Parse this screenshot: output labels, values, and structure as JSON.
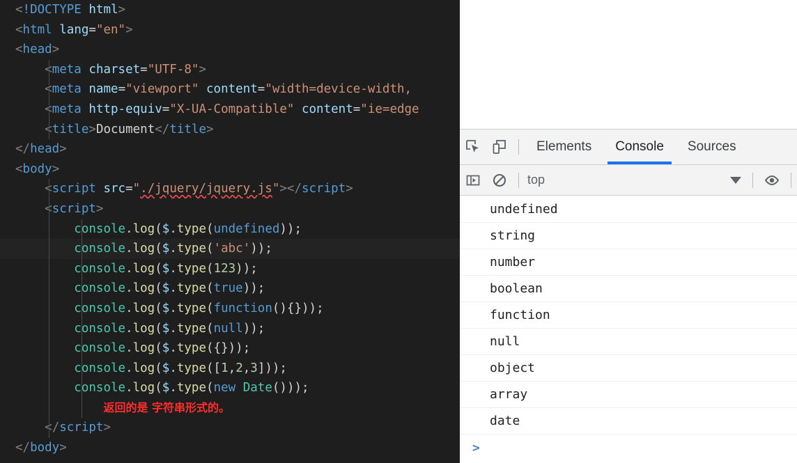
{
  "editor": {
    "language": "html",
    "background": "#1e1e1e",
    "lines": [
      {
        "indent": 0,
        "guides": 0,
        "highlight": false,
        "tokens": [
          {
            "t": "punct",
            "s": "<"
          },
          {
            "t": "doctype",
            "s": "!DOCTYPE"
          },
          {
            "t": "text",
            "s": " "
          },
          {
            "t": "dt-word",
            "s": "html"
          },
          {
            "t": "punct",
            "s": ">"
          }
        ]
      },
      {
        "indent": 0,
        "guides": 0,
        "highlight": false,
        "tokens": [
          {
            "t": "punct",
            "s": "<"
          },
          {
            "t": "tag",
            "s": "html"
          },
          {
            "t": "text",
            "s": " "
          },
          {
            "t": "attr",
            "s": "lang"
          },
          {
            "t": "op",
            "s": "="
          },
          {
            "t": "str",
            "s": "\"en\""
          },
          {
            "t": "punct",
            "s": ">"
          }
        ]
      },
      {
        "indent": 0,
        "guides": 0,
        "highlight": false,
        "tokens": [
          {
            "t": "punct",
            "s": "<"
          },
          {
            "t": "tag",
            "s": "head"
          },
          {
            "t": "punct",
            "s": ">"
          }
        ]
      },
      {
        "indent": 1,
        "guides": 1,
        "highlight": false,
        "tokens": [
          {
            "t": "punct",
            "s": "<"
          },
          {
            "t": "tag",
            "s": "meta"
          },
          {
            "t": "text",
            "s": " "
          },
          {
            "t": "attr",
            "s": "charset"
          },
          {
            "t": "op",
            "s": "="
          },
          {
            "t": "str",
            "s": "\"UTF-8\""
          },
          {
            "t": "punct",
            "s": ">"
          }
        ]
      },
      {
        "indent": 1,
        "guides": 1,
        "highlight": false,
        "tokens": [
          {
            "t": "punct",
            "s": "<"
          },
          {
            "t": "tag",
            "s": "meta"
          },
          {
            "t": "text",
            "s": " "
          },
          {
            "t": "attr",
            "s": "name"
          },
          {
            "t": "op",
            "s": "="
          },
          {
            "t": "str",
            "s": "\"viewport\""
          },
          {
            "t": "text",
            "s": " "
          },
          {
            "t": "attr",
            "s": "content"
          },
          {
            "t": "op",
            "s": "="
          },
          {
            "t": "str",
            "s": "\"width=device-width,"
          }
        ]
      },
      {
        "indent": 1,
        "guides": 1,
        "highlight": false,
        "tokens": [
          {
            "t": "punct",
            "s": "<"
          },
          {
            "t": "tag",
            "s": "meta"
          },
          {
            "t": "text",
            "s": " "
          },
          {
            "t": "attr",
            "s": "http-equiv"
          },
          {
            "t": "op",
            "s": "="
          },
          {
            "t": "str",
            "s": "\"X-UA-Compatible\""
          },
          {
            "t": "text",
            "s": " "
          },
          {
            "t": "attr",
            "s": "content"
          },
          {
            "t": "op",
            "s": "="
          },
          {
            "t": "str",
            "s": "\"ie=edge"
          }
        ]
      },
      {
        "indent": 1,
        "guides": 1,
        "highlight": false,
        "tokens": [
          {
            "t": "punct",
            "s": "<"
          },
          {
            "t": "tag",
            "s": "title"
          },
          {
            "t": "punct",
            "s": ">"
          },
          {
            "t": "text",
            "s": "Document"
          },
          {
            "t": "punct",
            "s": "</"
          },
          {
            "t": "tag",
            "s": "title"
          },
          {
            "t": "punct",
            "s": ">"
          }
        ]
      },
      {
        "indent": 0,
        "guides": 0,
        "highlight": false,
        "tokens": [
          {
            "t": "punct",
            "s": "</"
          },
          {
            "t": "tag",
            "s": "head"
          },
          {
            "t": "punct",
            "s": ">"
          }
        ]
      },
      {
        "indent": 0,
        "guides": 0,
        "highlight": false,
        "tokens": [
          {
            "t": "punct",
            "s": "<"
          },
          {
            "t": "tag",
            "s": "body"
          },
          {
            "t": "punct",
            "s": ">"
          }
        ]
      },
      {
        "indent": 1,
        "guides": 1,
        "highlight": false,
        "tokens": [
          {
            "t": "punct",
            "s": "<"
          },
          {
            "t": "tag",
            "s": "script"
          },
          {
            "t": "text",
            "s": " "
          },
          {
            "t": "attr",
            "s": "src"
          },
          {
            "t": "op",
            "s": "="
          },
          {
            "t": "str",
            "s": "\""
          },
          {
            "t": "str",
            "s": "./jquery/jquery.js",
            "error": true
          },
          {
            "t": "str",
            "s": "\""
          },
          {
            "t": "punct",
            "s": "></"
          },
          {
            "t": "tag",
            "s": "script"
          },
          {
            "t": "punct",
            "s": ">"
          }
        ]
      },
      {
        "indent": 1,
        "guides": 1,
        "highlight": false,
        "tokens": [
          {
            "t": "punct",
            "s": "<"
          },
          {
            "t": "tag",
            "s": "script"
          },
          {
            "t": "punct",
            "s": ">"
          }
        ]
      },
      {
        "indent": 2,
        "guides": 2,
        "highlight": false,
        "tokens": [
          {
            "t": "obj",
            "s": "console"
          },
          {
            "t": "op",
            "s": "."
          },
          {
            "t": "fn",
            "s": "log"
          },
          {
            "t": "op",
            "s": "("
          },
          {
            "t": "prop",
            "s": "$"
          },
          {
            "t": "op",
            "s": "."
          },
          {
            "t": "fn",
            "s": "type"
          },
          {
            "t": "op",
            "s": "("
          },
          {
            "t": "kw",
            "s": "undefined"
          },
          {
            "t": "op",
            "s": "));"
          }
        ]
      },
      {
        "indent": 2,
        "guides": 2,
        "highlight": true,
        "tokens": [
          {
            "t": "obj",
            "s": "console"
          },
          {
            "t": "op",
            "s": "."
          },
          {
            "t": "fn",
            "s": "log"
          },
          {
            "t": "op",
            "s": "("
          },
          {
            "t": "prop",
            "s": "$"
          },
          {
            "t": "op",
            "s": "."
          },
          {
            "t": "fn",
            "s": "type"
          },
          {
            "t": "op",
            "s": "("
          },
          {
            "t": "str",
            "s": "'abc'"
          },
          {
            "t": "op",
            "s": "));"
          }
        ]
      },
      {
        "indent": 2,
        "guides": 2,
        "highlight": false,
        "tokens": [
          {
            "t": "obj",
            "s": "console"
          },
          {
            "t": "op",
            "s": "."
          },
          {
            "t": "fn",
            "s": "log"
          },
          {
            "t": "op",
            "s": "("
          },
          {
            "t": "prop",
            "s": "$"
          },
          {
            "t": "op",
            "s": "."
          },
          {
            "t": "fn",
            "s": "type"
          },
          {
            "t": "op",
            "s": "("
          },
          {
            "t": "num",
            "s": "123"
          },
          {
            "t": "op",
            "s": "));"
          }
        ]
      },
      {
        "indent": 2,
        "guides": 2,
        "highlight": false,
        "tokens": [
          {
            "t": "obj",
            "s": "console"
          },
          {
            "t": "op",
            "s": "."
          },
          {
            "t": "fn",
            "s": "log"
          },
          {
            "t": "op",
            "s": "("
          },
          {
            "t": "prop",
            "s": "$"
          },
          {
            "t": "op",
            "s": "."
          },
          {
            "t": "fn",
            "s": "type"
          },
          {
            "t": "op",
            "s": "("
          },
          {
            "t": "kw",
            "s": "true"
          },
          {
            "t": "op",
            "s": "));"
          }
        ]
      },
      {
        "indent": 2,
        "guides": 2,
        "highlight": false,
        "tokens": [
          {
            "t": "obj",
            "s": "console"
          },
          {
            "t": "op",
            "s": "."
          },
          {
            "t": "fn",
            "s": "log"
          },
          {
            "t": "op",
            "s": "("
          },
          {
            "t": "prop",
            "s": "$"
          },
          {
            "t": "op",
            "s": "."
          },
          {
            "t": "fn",
            "s": "type"
          },
          {
            "t": "op",
            "s": "("
          },
          {
            "t": "kw",
            "s": "function"
          },
          {
            "t": "op",
            "s": "(){}));"
          }
        ]
      },
      {
        "indent": 2,
        "guides": 2,
        "highlight": false,
        "tokens": [
          {
            "t": "obj",
            "s": "console"
          },
          {
            "t": "op",
            "s": "."
          },
          {
            "t": "fn",
            "s": "log"
          },
          {
            "t": "op",
            "s": "("
          },
          {
            "t": "prop",
            "s": "$"
          },
          {
            "t": "op",
            "s": "."
          },
          {
            "t": "fn",
            "s": "type"
          },
          {
            "t": "op",
            "s": "("
          },
          {
            "t": "kw",
            "s": "null"
          },
          {
            "t": "op",
            "s": "));"
          }
        ]
      },
      {
        "indent": 2,
        "guides": 2,
        "highlight": false,
        "tokens": [
          {
            "t": "obj",
            "s": "console"
          },
          {
            "t": "op",
            "s": "."
          },
          {
            "t": "fn",
            "s": "log"
          },
          {
            "t": "op",
            "s": "("
          },
          {
            "t": "prop",
            "s": "$"
          },
          {
            "t": "op",
            "s": "."
          },
          {
            "t": "fn",
            "s": "type"
          },
          {
            "t": "op",
            "s": "({}));"
          }
        ]
      },
      {
        "indent": 2,
        "guides": 2,
        "highlight": false,
        "tokens": [
          {
            "t": "obj",
            "s": "console"
          },
          {
            "t": "op",
            "s": "."
          },
          {
            "t": "fn",
            "s": "log"
          },
          {
            "t": "op",
            "s": "("
          },
          {
            "t": "prop",
            "s": "$"
          },
          {
            "t": "op",
            "s": "."
          },
          {
            "t": "fn",
            "s": "type"
          },
          {
            "t": "op",
            "s": "(["
          },
          {
            "t": "num",
            "s": "1"
          },
          {
            "t": "op",
            "s": ","
          },
          {
            "t": "num",
            "s": "2"
          },
          {
            "t": "op",
            "s": ","
          },
          {
            "t": "num",
            "s": "3"
          },
          {
            "t": "op",
            "s": "]));"
          }
        ]
      },
      {
        "indent": 2,
        "guides": 2,
        "highlight": false,
        "tokens": [
          {
            "t": "obj",
            "s": "console"
          },
          {
            "t": "op",
            "s": "."
          },
          {
            "t": "fn",
            "s": "log"
          },
          {
            "t": "op",
            "s": "("
          },
          {
            "t": "prop",
            "s": "$"
          },
          {
            "t": "op",
            "s": "."
          },
          {
            "t": "fn",
            "s": "type"
          },
          {
            "t": "op",
            "s": "("
          },
          {
            "t": "kw",
            "s": "new"
          },
          {
            "t": "text",
            "s": " "
          },
          {
            "t": "cls",
            "s": "Date"
          },
          {
            "t": "op",
            "s": "()));"
          }
        ]
      },
      {
        "indent": 0,
        "guides": 2,
        "highlight": false,
        "note": true,
        "tokens": []
      },
      {
        "indent": 1,
        "guides": 1,
        "highlight": false,
        "tokens": [
          {
            "t": "punct",
            "s": "</"
          },
          {
            "t": "tag",
            "s": "script"
          },
          {
            "t": "punct",
            "s": ">"
          }
        ]
      },
      {
        "indent": 0,
        "guides": 0,
        "highlight": false,
        "tokens": [
          {
            "t": "punct",
            "s": "</"
          },
          {
            "t": "tag",
            "s": "body"
          },
          {
            "t": "punct",
            "s": ">"
          }
        ]
      }
    ],
    "annotation": {
      "text": "返回的是 字符串形式的。",
      "color": "#ff2d2d"
    }
  },
  "devtools": {
    "accent_color": "#1a73e8",
    "toolbar_icons": [
      {
        "name": "inspect-element-icon",
        "title": "Inspect"
      },
      {
        "name": "device-toolbar-icon",
        "title": "Toggle device toolbar"
      }
    ],
    "tabs": [
      {
        "label": "Elements",
        "active": false
      },
      {
        "label": "Console",
        "active": true
      },
      {
        "label": "Sources",
        "active": false
      }
    ],
    "console_toolbar": {
      "sidebar_toggle": "console-sidebar-icon",
      "clear_label": "clear-console-icon",
      "context": "top",
      "eye_icon": "live-expression-icon"
    },
    "console_output": [
      "undefined",
      "string",
      "number",
      "boolean",
      "function",
      "null",
      "object",
      "array",
      "date"
    ],
    "prompt_symbol": ">"
  }
}
